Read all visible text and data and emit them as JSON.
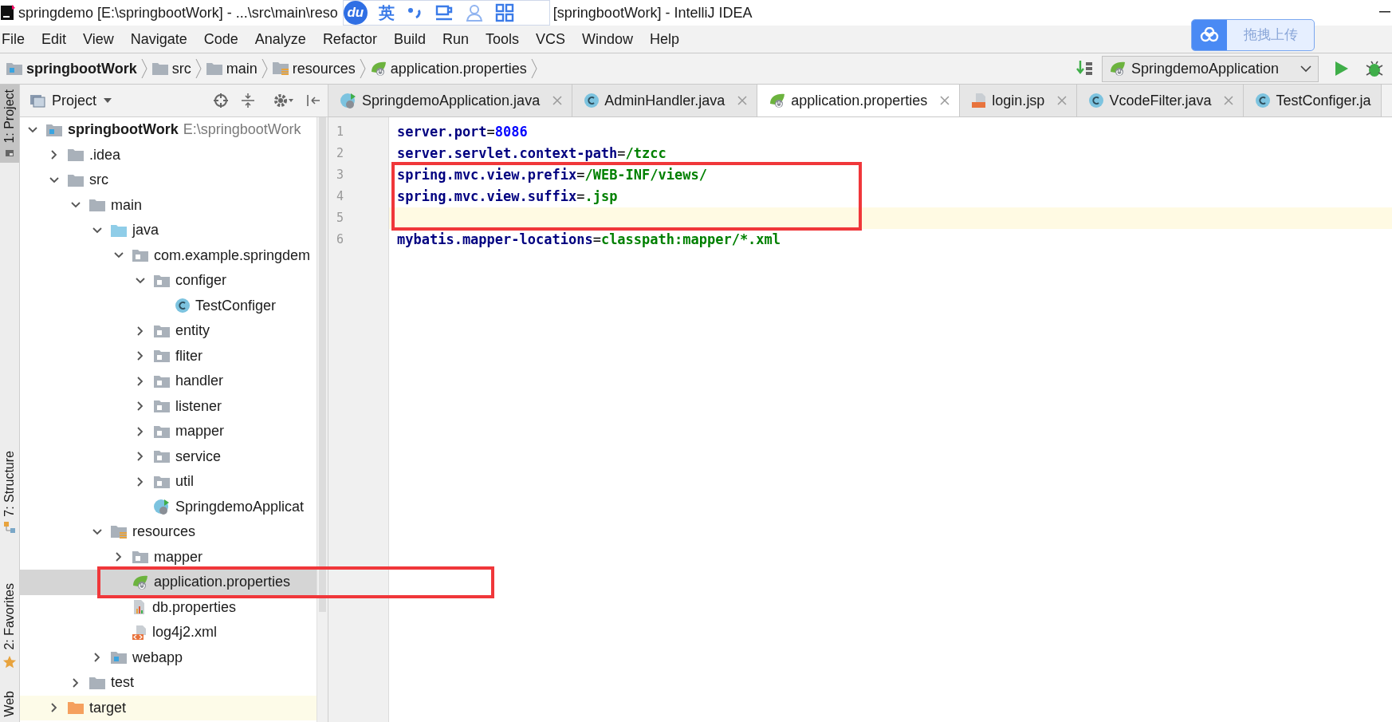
{
  "title_bar": {
    "title_start": "springdemo [E:\\springbootWork] - ...\\src\\main\\reso",
    "title_end": "[springbootWork] - IntelliJ IDEA"
  },
  "ime_toolbar": {
    "logo": "du",
    "language": "英"
  },
  "upload_button": {
    "label": "拖拽上传"
  },
  "menu": [
    "File",
    "Edit",
    "View",
    "Navigate",
    "Code",
    "Analyze",
    "Refactor",
    "Build",
    "Run",
    "Tools",
    "VCS",
    "Window",
    "Help"
  ],
  "breadcrumbs": [
    {
      "label": "springbootWork",
      "kind": "module"
    },
    {
      "label": "src",
      "kind": "folder"
    },
    {
      "label": "main",
      "kind": "folder"
    },
    {
      "label": "resources",
      "kind": "resources-folder"
    },
    {
      "label": "application.properties",
      "kind": "spring-properties"
    }
  ],
  "run_config": {
    "label": "SpringdemoApplication"
  },
  "tool_windows": [
    {
      "label": "1: Project",
      "selected": true,
      "kind": "project"
    },
    {
      "label": "7: Structure",
      "selected": false,
      "kind": "structure"
    },
    {
      "label": "2: Favorites",
      "selected": false,
      "kind": "favorites"
    },
    {
      "label": "Web",
      "selected": false,
      "kind": "web"
    }
  ],
  "project_panel": {
    "title": "Project",
    "tree": [
      {
        "label": "springbootWork",
        "path": "E:\\springbootWork",
        "kind": "module",
        "expanded": true,
        "selected": false,
        "children": [
          {
            "label": ".idea",
            "kind": "folder",
            "expanded": false,
            "selected": false
          },
          {
            "label": "src",
            "kind": "folder",
            "expanded": true,
            "selected": false,
            "children": [
              {
                "label": "main",
                "kind": "folder",
                "expanded": true,
                "selected": false,
                "children": [
                  {
                    "label": "java",
                    "kind": "source-folder",
                    "expanded": true,
                    "selected": false,
                    "children": [
                      {
                        "label": "com.example.springdem",
                        "kind": "package",
                        "expanded": true,
                        "selected": false,
                        "children": [
                          {
                            "label": "configer",
                            "kind": "package",
                            "expanded": true,
                            "selected": false,
                            "children": [
                              {
                                "label": "TestConfiger",
                                "kind": "class",
                                "selected": false
                              }
                            ]
                          },
                          {
                            "label": "entity",
                            "kind": "package",
                            "expanded": false,
                            "selected": false
                          },
                          {
                            "label": "fliter",
                            "kind": "package",
                            "expanded": false,
                            "selected": false
                          },
                          {
                            "label": "handler",
                            "kind": "package",
                            "expanded": false,
                            "selected": false
                          },
                          {
                            "label": "listener",
                            "kind": "package",
                            "expanded": false,
                            "selected": false
                          },
                          {
                            "label": "mapper",
                            "kind": "package",
                            "expanded": false,
                            "selected": false
                          },
                          {
                            "label": "service",
                            "kind": "package",
                            "expanded": false,
                            "selected": false
                          },
                          {
                            "label": "util",
                            "kind": "package",
                            "expanded": false,
                            "selected": false
                          },
                          {
                            "label": "SpringdemoApplicat",
                            "kind": "spring-class",
                            "selected": false
                          }
                        ]
                      }
                    ]
                  },
                  {
                    "label": "resources",
                    "kind": "resources-folder",
                    "expanded": true,
                    "selected": false,
                    "children": [
                      {
                        "label": "mapper",
                        "kind": "package",
                        "expanded": false,
                        "selected": false
                      },
                      {
                        "label": "application.properties",
                        "kind": "spring-properties",
                        "selected": true
                      },
                      {
                        "label": "db.properties",
                        "kind": "properties",
                        "selected": false
                      },
                      {
                        "label": "log4j2.xml",
                        "kind": "xml",
                        "selected": false
                      }
                    ]
                  },
                  {
                    "label": "webapp",
                    "kind": "web-folder",
                    "expanded": false,
                    "selected": false
                  }
                ]
              },
              {
                "label": "test",
                "kind": "folder",
                "expanded": false,
                "selected": false
              }
            ]
          },
          {
            "label": "target",
            "kind": "excluded-folder",
            "expanded": false,
            "selected": false
          }
        ]
      }
    ]
  },
  "editor_tabs": [
    {
      "label": "SpringdemoApplication.java",
      "kind": "spring-class",
      "selected": false
    },
    {
      "label": "AdminHandler.java",
      "kind": "class",
      "selected": false
    },
    {
      "label": "application.properties",
      "kind": "spring-properties",
      "selected": true
    },
    {
      "label": "login.jsp",
      "kind": "jsp",
      "selected": false
    },
    {
      "label": "VcodeFilter.java",
      "kind": "class",
      "selected": false
    },
    {
      "label": "TestConfiger.ja",
      "kind": "class",
      "selected": false
    }
  ],
  "editor": {
    "lines": [
      {
        "number": "1",
        "current": false,
        "segments": [
          {
            "text": "server.port",
            "kind": "key"
          },
          {
            "text": "=",
            "kind": "separator"
          },
          {
            "text": "8086",
            "kind": "number"
          }
        ]
      },
      {
        "number": "2",
        "current": false,
        "segments": [
          {
            "text": "server.servlet.context-path",
            "kind": "key"
          },
          {
            "text": "=",
            "kind": "separator"
          },
          {
            "text": "/tzcc",
            "kind": "value"
          }
        ]
      },
      {
        "number": "3",
        "current": false,
        "segments": [
          {
            "text": "spring.mvc.view.prefix",
            "kind": "key"
          },
          {
            "text": "=",
            "kind": "separator"
          },
          {
            "text": "/WEB-INF/views/",
            "kind": "value"
          }
        ]
      },
      {
        "number": "4",
        "current": false,
        "segments": [
          {
            "text": "spring.mvc.view.suffix",
            "kind": "key"
          },
          {
            "text": "=",
            "kind": "separator"
          },
          {
            "text": ".jsp",
            "kind": "value"
          }
        ]
      },
      {
        "number": "5",
        "current": true
      },
      {
        "number": "6",
        "current": false,
        "segments": [
          {
            "text": "mybatis.mapper-locations",
            "kind": "key"
          },
          {
            "text": "=",
            "kind": "separator"
          },
          {
            "text": "classpath:mapper/*.xml",
            "kind": "value"
          }
        ]
      }
    ]
  }
}
